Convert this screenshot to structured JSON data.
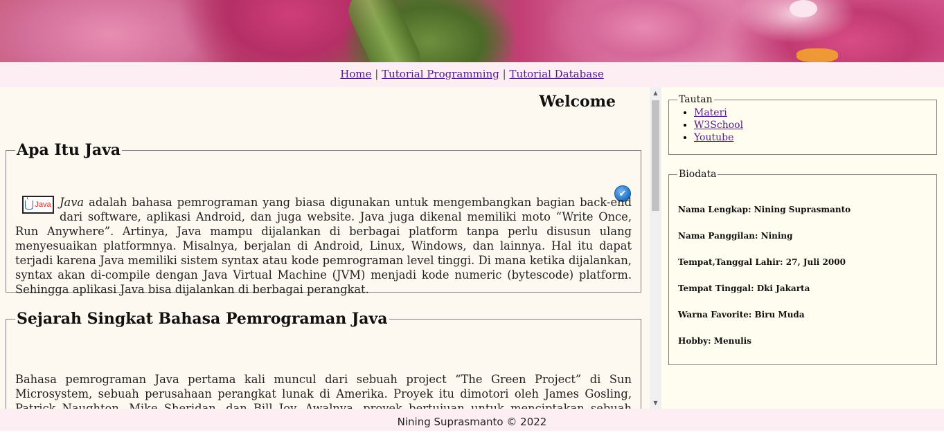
{
  "nav": {
    "items": [
      "Home",
      "Tutorial Programming",
      "Tutorial Database"
    ],
    "separator": "|"
  },
  "main": {
    "welcome": "Welcome",
    "section1": {
      "title": "Apa Itu Java",
      "logo_text": "Java",
      "intro_word": "Java",
      "text": " adalah bahasa pemrograman yang biasa digunakan untuk mengembangkan bagian back-end dari software, aplikasi Android, dan juga website. Java juga dikenal memiliki moto “Write Once, Run Anywhere”. Artinya, Java mampu dijalankan di berbagai platform tanpa perlu disusun ulang menyesuaikan platformnya. Misalnya, berjalan di Android, Linux, Windows, dan lainnya. Hal itu dapat terjadi karena Java memiliki sistem syntax atau kode pemrograman level tinggi. Di mana ketika dijalankan, syntax akan di-compile dengan Java Virtual Machine (JVM) menjadi kode numeric (bytescode) platform. Sehingga aplikasi Java bisa dijalankan di berbagai perangkat."
    },
    "section2": {
      "title": "Sejarah Singkat Bahasa Pemrograman Java",
      "text": "Bahasa pemrograman Java pertama kali muncul dari sebuah project “The Green Project” di Sun Microsystem, sebuah perusahaan perangkat lunak di Amerika. Proyek itu dimotori oleh James Gosling, Patrick Naughton, Mike Sheridan, dan Bill Joy. Awalnya, proyek bertujuan untuk menciptakan sebuah peralatan pintar. Namun, karena tak puas dengan hasil dari bahasa pemrograman C++ dan C, mereka memutuskan untuk membuat bahasa pemrograman sendiri yang"
    }
  },
  "sidebar": {
    "tautan": {
      "legend": "Tautan",
      "links": [
        "Materi",
        "W3School",
        "Youtube"
      ]
    },
    "biodata": {
      "legend": "Biodata",
      "rows": [
        "Nama Lengkap: Nining Suprasmanto",
        "Nama Panggilan: Nining",
        "Tempat,Tanggal Lahir: 27, Juli 2000",
        "Tempat Tinggal: Dki Jakarta",
        "Warna Favorite: Biru Muda",
        "Hobby: Menulis"
      ]
    }
  },
  "footer": {
    "text": "Nining Suprasmanto © 2022"
  },
  "icons": {
    "check": "✔",
    "scroll_up": "▲",
    "scroll_down": "▼"
  },
  "colors": {
    "nav_bg": "#fdeef4",
    "main_bg": "#fef9f0",
    "sidebar_bg": "#fffdf0",
    "link": "#551a8b"
  }
}
